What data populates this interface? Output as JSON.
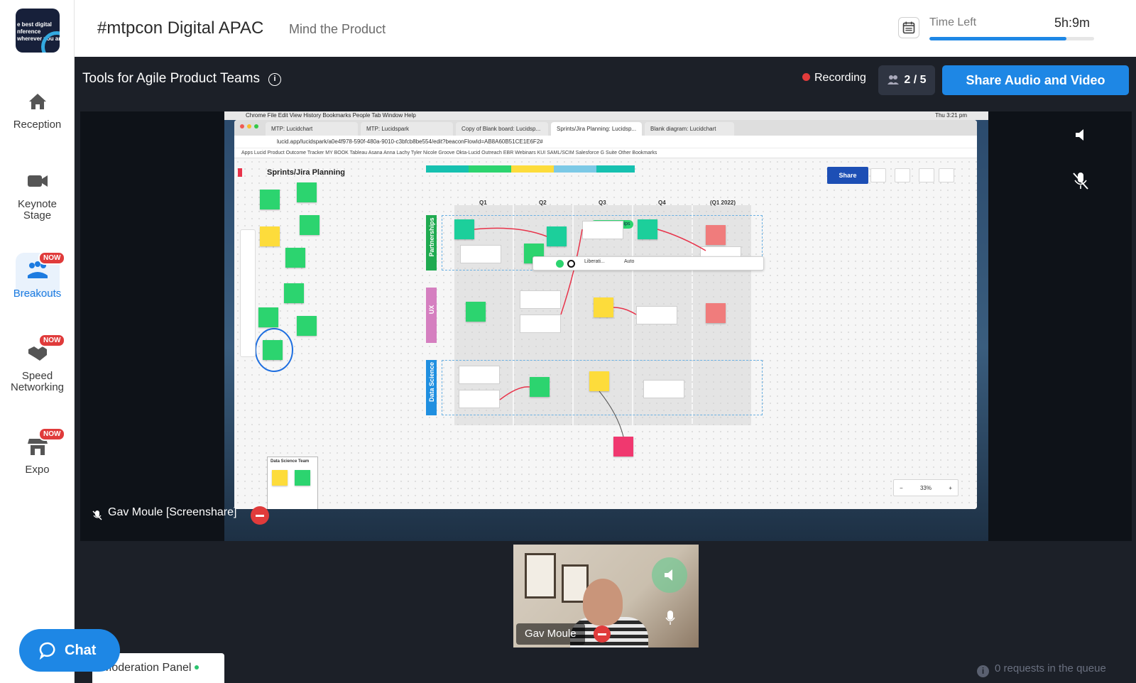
{
  "sidebar": {
    "logo_lines": [
      "e best digital",
      "nference",
      "wherever you are"
    ],
    "items": [
      {
        "label": "Reception",
        "icon": "home-icon"
      },
      {
        "label": "Keynote Stage",
        "icon": "video-camera-icon"
      },
      {
        "label": "Breakouts",
        "icon": "people-group-icon",
        "badge": "NOW",
        "active": true
      },
      {
        "label": "Speed Networking",
        "icon": "handshake-icon",
        "badge": "NOW"
      },
      {
        "label": "Expo",
        "icon": "booth-icon",
        "badge": "NOW"
      }
    ]
  },
  "header": {
    "title": "#mtpcon Digital APAC",
    "organizer": "Mind the Product",
    "time_left_label": "Time Left",
    "time_left_value": "5h:9m",
    "time_progress": 0.83
  },
  "stage": {
    "title": "Tools for Agile Product Teams",
    "recording_label": "Recording",
    "participants": "2 / 5",
    "share_button": "Share Audio and Video"
  },
  "screenshare": {
    "caption": "Gav Moule [Screenshare]",
    "mac_menu": "Chrome   File   Edit   View   History   Bookmarks   People   Tab   Window   Help",
    "mac_clock": "Thu 3:21 pm",
    "tabs": [
      "MTP: Lucidchart",
      "MTP: Lucidspark",
      "Copy of Blank board: Lucidsp...",
      "Sprints/Jira Planning: Lucidsp...",
      "Blank diagram: Lucidchart"
    ],
    "url": "lucid.app/lucidspark/a0e4f978-590f-480a-9010-c3bfcb8be554/edit?beaconFlowId=AB8A60B51CE1E6F2#",
    "bookmarks": "Apps   Lucid Product   Outcome Tracker   MY BOOK   Tableau   Asana   Anna   Lachy   Tyler   Nicole   Groove   Okta-Lucid   Outreach   EBR   Webinars   KUI   SAML/SCIM   Salesforce   G Suite   Other Bookmarks",
    "doc_title": "Sprints/Jira Planning",
    "share_label": "Share",
    "columns": [
      "Q1",
      "Q2",
      "Q3",
      "Q4",
      "(Q1 2022)"
    ],
    "rows": [
      "Partnerships",
      "UX",
      "Data Science"
    ],
    "bo_partnerships": "BD Partnerships",
    "font_label": "Liberati...",
    "auto_label": "Auto",
    "zoom": "33%",
    "data_science_team": "Data Science Team"
  },
  "camera": {
    "name": "Gav Moule"
  },
  "bottom": {
    "chat_label": "Chat",
    "moderation_label": "Moderation Panel",
    "queue_text": "0 requests in the queue"
  },
  "colors": {
    "accent": "#1e87e5",
    "danger": "#e03b3b",
    "badge": "#e03b3b"
  }
}
